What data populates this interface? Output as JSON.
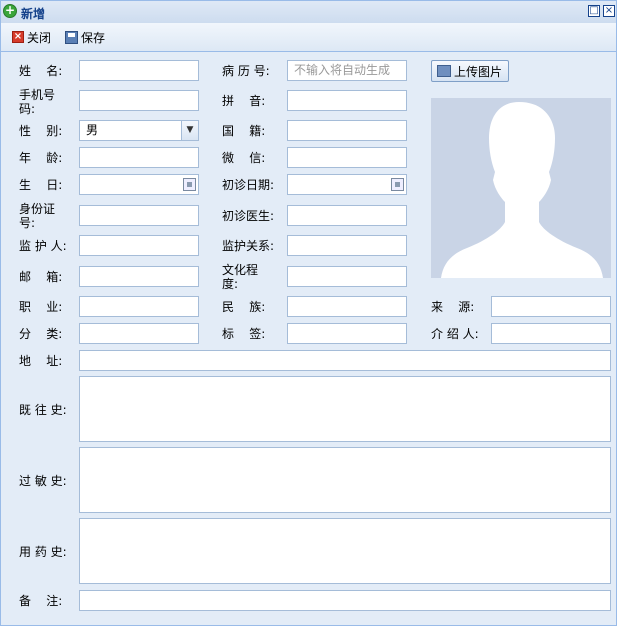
{
  "window": {
    "title": "新增"
  },
  "toolbar": {
    "close_label": "关闭",
    "save_label": "保存"
  },
  "upload": {
    "label": "上传图片"
  },
  "fields": {
    "name": {
      "label": "姓    名:",
      "value": ""
    },
    "record_no": {
      "label": "病 历 号:",
      "value": "",
      "placeholder": "不输入将自动生成"
    },
    "phone": {
      "label": "手机号码:",
      "value": ""
    },
    "pinyin": {
      "label": "拼    音:",
      "value": ""
    },
    "gender": {
      "label": "性    别:",
      "value": "男"
    },
    "nationality": {
      "label": "国    籍:",
      "value": ""
    },
    "age": {
      "label": "年    龄:",
      "value": ""
    },
    "wechat": {
      "label": "微    信:",
      "value": ""
    },
    "birthday": {
      "label": "生    日:",
      "value": ""
    },
    "first_visit_date": {
      "label": "初诊日期:",
      "value": ""
    },
    "id_no": {
      "label": "身份证号:",
      "value": ""
    },
    "first_doctor": {
      "label": "初诊医生:",
      "value": ""
    },
    "guardian": {
      "label": "监 护 人:",
      "value": ""
    },
    "guardian_relation": {
      "label": "监护关系:",
      "value": ""
    },
    "email": {
      "label": "邮    箱:",
      "value": ""
    },
    "education": {
      "label": "文化程度:",
      "value": ""
    },
    "occupation": {
      "label": "职    业:",
      "value": ""
    },
    "ethnicity": {
      "label": "民    族:",
      "value": ""
    },
    "source": {
      "label": "来    源:",
      "value": ""
    },
    "category": {
      "label": "分    类:",
      "value": ""
    },
    "tag": {
      "label": "标    签:",
      "value": ""
    },
    "referrer": {
      "label": "介 绍 人:",
      "value": ""
    },
    "address": {
      "label": "地    址:",
      "value": ""
    },
    "medical_history": {
      "label": "既 往 史:",
      "value": ""
    },
    "allergy_history": {
      "label": "过 敏 史:",
      "value": ""
    },
    "medication_history": {
      "label": "用 药 史:",
      "value": ""
    },
    "remarks": {
      "label": "备    注:",
      "value": ""
    }
  }
}
